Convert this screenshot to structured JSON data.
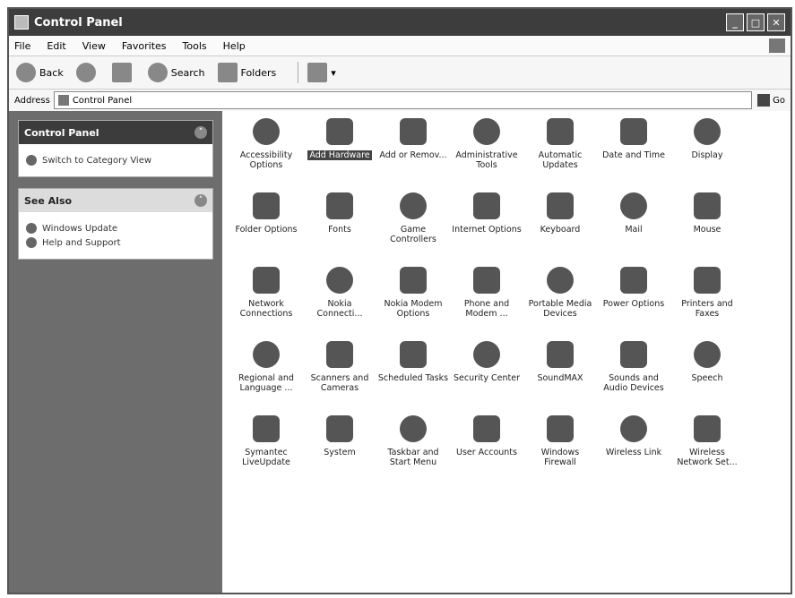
{
  "window": {
    "title": "Control Panel"
  },
  "menu": [
    "File",
    "Edit",
    "View",
    "Favorites",
    "Tools",
    "Help"
  ],
  "toolbar": {
    "back": "Back",
    "search": "Search",
    "folders": "Folders"
  },
  "address": {
    "label": "Address",
    "value": "Control Panel",
    "go": "Go"
  },
  "sidebar": {
    "control_panel": {
      "title": "Control Panel",
      "switch_link": "Switch to Category View"
    },
    "see_also": {
      "title": "See Also",
      "links": [
        "Windows Update",
        "Help and Support"
      ]
    }
  },
  "items": [
    "Accessibility Options",
    "Add Hardware",
    "Add or Remov...",
    "Administrative Tools",
    "Automatic Updates",
    "Date and Time",
    "Display",
    "Folder Options",
    "Fonts",
    "Game Controllers",
    "Internet Options",
    "Keyboard",
    "Mail",
    "Mouse",
    "Network Connections",
    "Nokia Connecti...",
    "Nokia Modem Options",
    "Phone and Modem ...",
    "Portable Media Devices",
    "Power Options",
    "Printers and Faxes",
    "Regional and Language ...",
    "Scanners and Cameras",
    "Scheduled Tasks",
    "Security Center",
    "SoundMAX",
    "Sounds and Audio Devices",
    "Speech",
    "Symantec LiveUpdate",
    "System",
    "Taskbar and Start Menu",
    "User Accounts",
    "Windows Firewall",
    "Wireless Link",
    "Wireless Network Set..."
  ],
  "selected_item": "Add Hardware"
}
